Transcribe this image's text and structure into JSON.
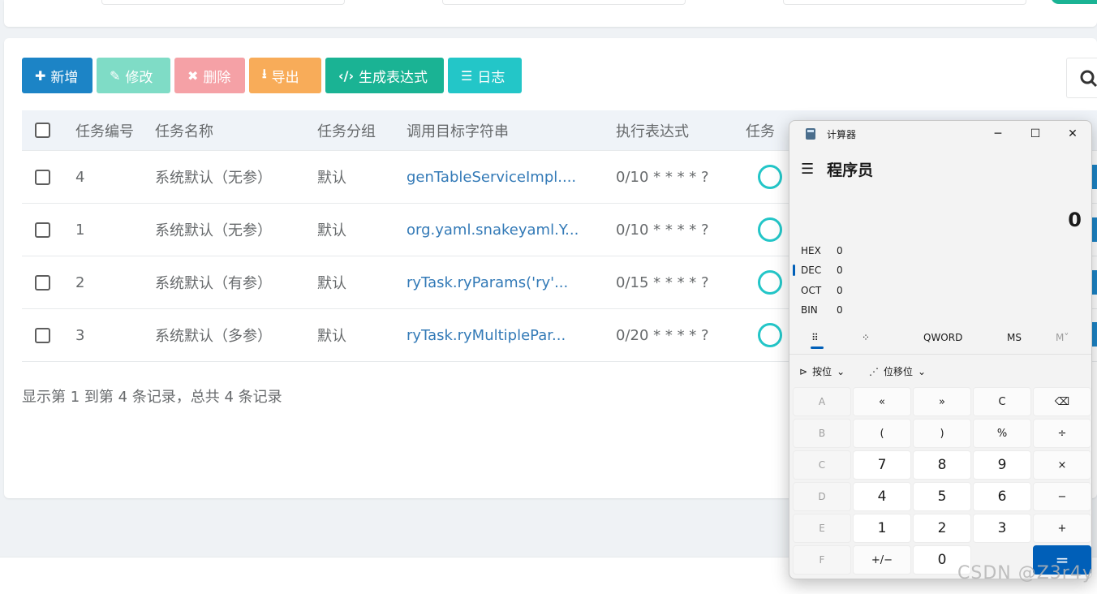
{
  "toolbar": {
    "add": "新增",
    "edit": "修改",
    "delete": "删除",
    "export": "导出",
    "generate": "生成表达式",
    "log": "日志"
  },
  "table": {
    "headers": [
      "任务编号",
      "任务名称",
      "任务分组",
      "调用目标字符串",
      "执行表达式",
      "任务"
    ],
    "rows": [
      {
        "id": "4",
        "name": "系统默认（无参）",
        "group": "默认",
        "target": "genTableServiceImpl....",
        "cron": "0/10 * * * * ?"
      },
      {
        "id": "1",
        "name": "系统默认（无参）",
        "group": "默认",
        "target": "org.yaml.snakeyaml.Y...",
        "cron": "0/10 * * * * ?"
      },
      {
        "id": "2",
        "name": "系统默认（有参）",
        "group": "默认",
        "target": "ryTask.ryParams('ry'...",
        "cron": "0/15 * * * * ?"
      },
      {
        "id": "3",
        "name": "系统默认（多参）",
        "group": "默认",
        "target": "ryTask.ryMultiplePar...",
        "cron": "0/20 * * * * ?"
      }
    ]
  },
  "pagination_text": "显示第 1 到第 4 条记录，总共 4 条记录",
  "calculator": {
    "window_title": "计算器",
    "mode_title": "程序员",
    "display": "0",
    "radix": [
      {
        "label": "HEX",
        "value": "0"
      },
      {
        "label": "DEC",
        "value": "0"
      },
      {
        "label": "OCT",
        "value": "0"
      },
      {
        "label": "BIN",
        "value": "0"
      }
    ],
    "word_size": "QWORD",
    "memory_store": "MS",
    "memory_menu": "M˅",
    "bitwise": "按位",
    "bitshift": "位移位",
    "keys": [
      "A",
      "«",
      "»",
      "C",
      "⌫",
      "B",
      "(",
      ")",
      "%",
      "÷",
      "C",
      "7",
      "8",
      "9",
      "×",
      "D",
      "4",
      "5",
      "6",
      "−",
      "E",
      "1",
      "2",
      "3",
      "+",
      "F",
      "+/−",
      "0",
      "",
      "="
    ]
  },
  "watermark": "CSDN @Z3r4y",
  "colors": {
    "primary": "#1c84c6",
    "success": "#1ab394",
    "info": "#23c6c8",
    "warning": "#f8ac59",
    "danger": "#f5a1a6",
    "calc_accent": "#005fb8"
  }
}
